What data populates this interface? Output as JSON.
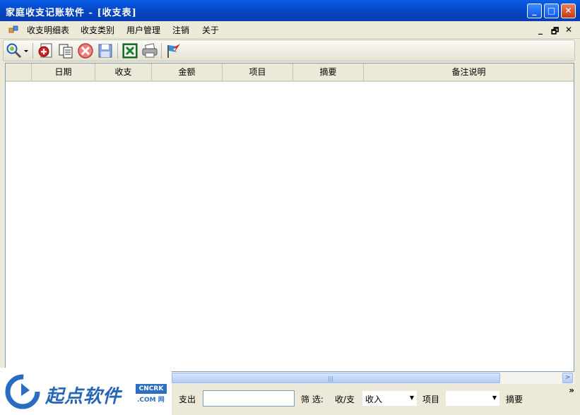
{
  "window": {
    "title": "家庭收支记账软件 - [收支表]",
    "buttons": {
      "minimize": "_",
      "maximize": "□",
      "close": "✕"
    }
  },
  "menu": {
    "items": [
      "收支明细表",
      "收支类别",
      "用户管理",
      "注销",
      "关于"
    ],
    "mdi_controls": {
      "minimize": "_",
      "restore": "🗗",
      "close": "✕"
    }
  },
  "toolbar": {
    "icons": [
      "search-icon",
      "add-record-icon",
      "copy-icon",
      "delete-icon",
      "save-icon",
      "excel-export-icon",
      "print-icon",
      "exit-flag-icon"
    ]
  },
  "grid": {
    "columns": [
      "",
      "日期",
      "收支",
      "金额",
      "项目",
      "摘要",
      "备注说明"
    ],
    "rows": []
  },
  "filter": {
    "expense_label": "支出",
    "expense_value": "",
    "filter_label": "筛 选:",
    "type_label": "收/支",
    "type_selected": "收入",
    "item_label": "项目",
    "item_selected": "",
    "summary_label": "摘要",
    "more": "»"
  },
  "watermark": {
    "text": "起点软件",
    "badge": "CNCRK",
    "domain": ".COM",
    "suffix": "网"
  },
  "colors": {
    "titlebar": "#0A4FD8",
    "accent": "#2766B5"
  }
}
